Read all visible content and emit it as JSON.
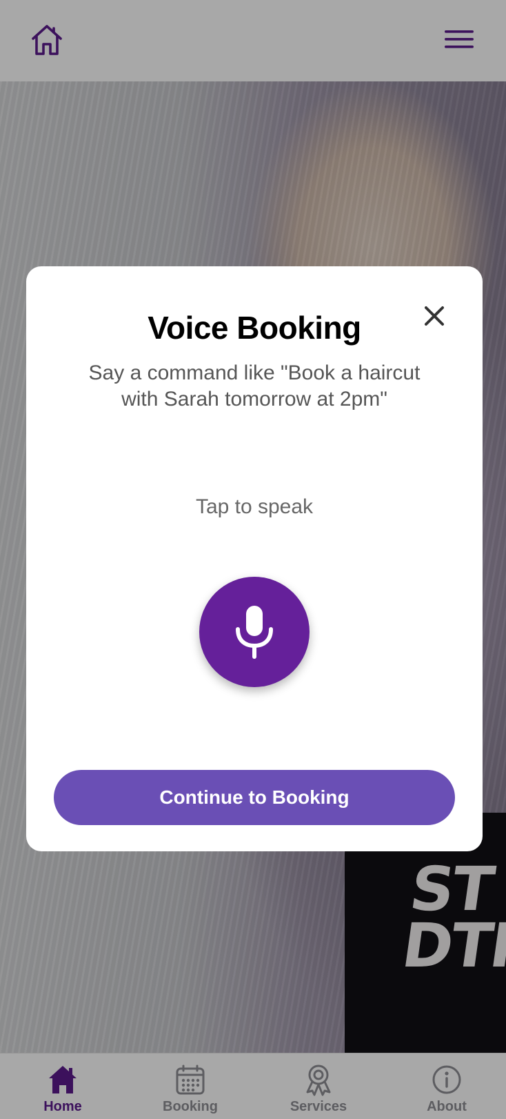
{
  "header": {
    "home_icon": "home-outline-icon",
    "menu_icon": "hamburger-menu-icon"
  },
  "hero": {
    "shirt_text_line1": "ST",
    "shirt_text_line2": "DTHI"
  },
  "modal": {
    "title": "Voice Booking",
    "subtitle": "Say a command like \"Book a haircut with Sarah tomorrow at 2pm\"",
    "tap_label": "Tap to speak",
    "continue_label": "Continue to Booking",
    "close_icon": "close-icon",
    "mic_icon": "microphone-icon"
  },
  "bottom_nav": {
    "items": [
      {
        "label": "Home",
        "icon": "home-filled-icon",
        "active": true
      },
      {
        "label": "Booking",
        "icon": "calendar-icon",
        "active": false
      },
      {
        "label": "Services",
        "icon": "award-ribbon-icon",
        "active": false
      },
      {
        "label": "About",
        "icon": "info-circle-icon",
        "active": false
      }
    ]
  },
  "colors": {
    "brand_purple": "#65209a",
    "button_purple": "#6a4fb5",
    "nav_inactive": "#8e8e93"
  }
}
